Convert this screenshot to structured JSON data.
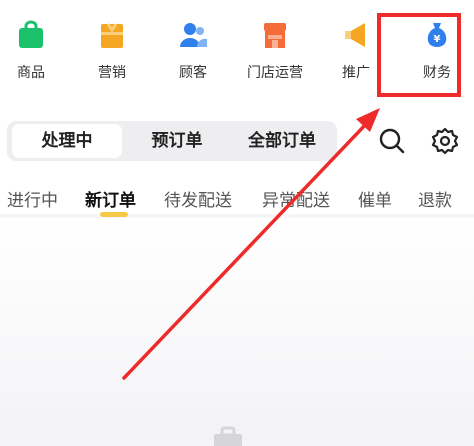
{
  "top_nav": {
    "items": [
      {
        "label": "商品",
        "icon": "shopping-bag-icon",
        "color": "#1bc26b"
      },
      {
        "label": "营销",
        "icon": "gift-icon",
        "color": "#f5a623"
      },
      {
        "label": "顾客",
        "icon": "users-icon",
        "color": "#2f80ed"
      },
      {
        "label": "门店运营",
        "icon": "store-icon",
        "color": "#f46c3a"
      },
      {
        "label": "推广",
        "icon": "megaphone-icon",
        "color": "#f5a623"
      },
      {
        "label": "财务",
        "icon": "money-bag-icon",
        "color": "#2f80ed",
        "badge": "¥"
      }
    ]
  },
  "order_tabs": {
    "items": [
      "处理中",
      "预订单",
      "全部订单"
    ],
    "active": "处理中"
  },
  "toolbar": {
    "search_icon": "search-icon",
    "settings_icon": "gear-icon"
  },
  "sub_tabs": {
    "items": [
      "进行中",
      "新订单",
      "待发配送",
      "异常配送",
      "催单",
      "退款"
    ],
    "active": "新订单",
    "indicator_color": "#f7c948"
  },
  "annotation": {
    "highlight_color": "#ee2a2a"
  }
}
